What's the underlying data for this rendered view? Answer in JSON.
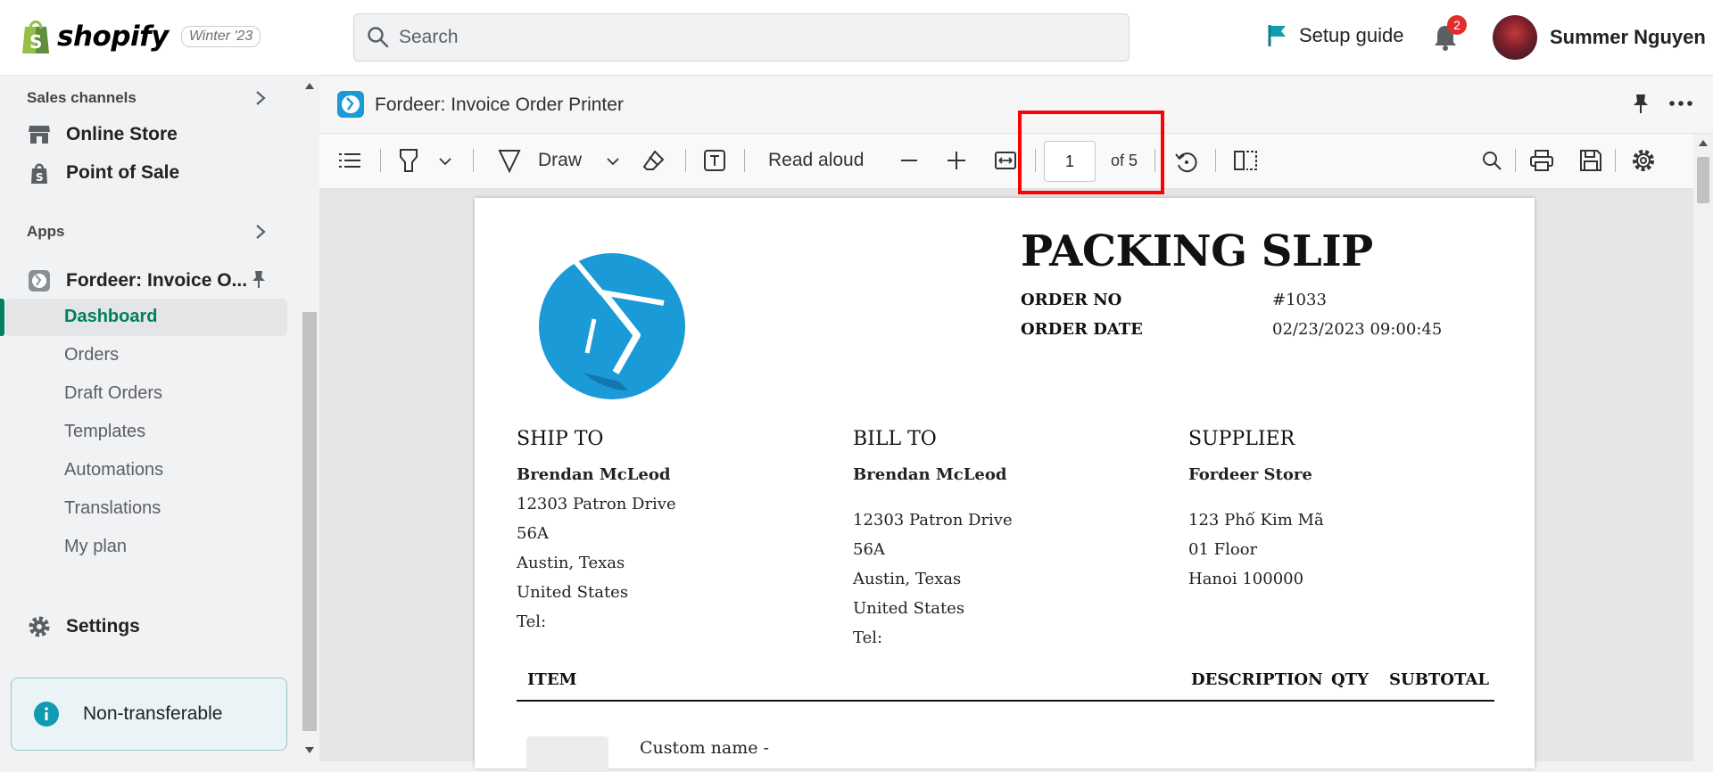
{
  "topbar": {
    "brand": "shopify",
    "edition": "Winter '23",
    "search_placeholder": "Search",
    "setup_guide": "Setup guide",
    "notification_count": "2",
    "user_name": "Summer Nguyen"
  },
  "sidebar": {
    "sales_channels_label": "Sales channels",
    "online_store": "Online Store",
    "point_of_sale": "Point of Sale",
    "apps_label": "Apps",
    "app_name": "Fordeer: Invoice O...",
    "sub_items": [
      "Dashboard",
      "Orders",
      "Draft Orders",
      "Templates",
      "Automations",
      "Translations",
      "My plan"
    ],
    "settings": "Settings",
    "banner": "Non-transferable"
  },
  "app_header": {
    "title": "Fordeer: Invoice Order Printer"
  },
  "pdf_toolbar": {
    "draw_label": "Draw",
    "read_aloud": "Read aloud",
    "current_page": "1",
    "of_pages": "of 5"
  },
  "document": {
    "title": "PACKING SLIP",
    "order_no_label": "ORDER NO",
    "order_no": "#1033",
    "order_date_label": "ORDER DATE",
    "order_date": "02/23/2023 09:00:45",
    "ship_to": {
      "heading": "SHIP TO",
      "name": "Brendan McLeod",
      "lines": [
        "12303 Patron Drive",
        "56A",
        "Austin, Texas",
        "United States",
        "Tel:"
      ]
    },
    "bill_to": {
      "heading": "BILL TO",
      "name": "Brendan McLeod",
      "lines": [
        "12303 Patron Drive",
        "56A",
        "Austin, Texas",
        "United States",
        "Tel:"
      ]
    },
    "supplier": {
      "heading": "SUPPLIER",
      "name": "Fordeer Store",
      "lines": [
        "123 Phố Kim Mã",
        "01 Floor",
        "Hanoi 100000"
      ]
    },
    "table_headers": {
      "item": "ITEM",
      "description": "DESCRIPTION",
      "qty": "QTY",
      "subtotal": "SUBTOTAL"
    },
    "first_item": "Custom name -"
  },
  "colors": {
    "accent_green": "#008060",
    "brand_blue": "#1a9ad6",
    "highlight_red": "#ff0000"
  }
}
